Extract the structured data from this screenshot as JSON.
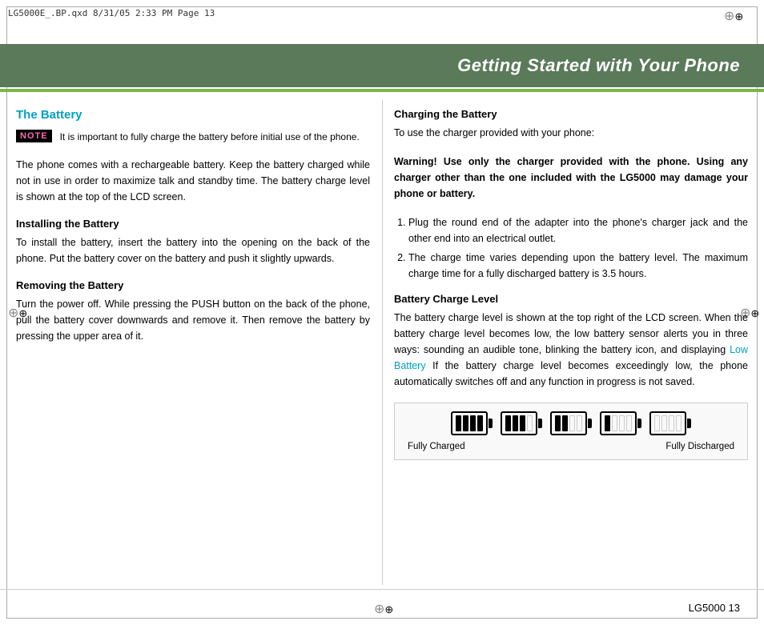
{
  "printer_header": "LG5000E_.BP.qxd   8/31/05   2:33 PM   Page 13",
  "title": "Getting Started with Your Phone",
  "left_column": {
    "section_title": "The Battery",
    "note_label": "NOTE",
    "note_text": "It is important to fully charge the battery before initial use of the phone.",
    "body_text": "The phone comes with a rechargeable battery. Keep the battery charged while not in use in order to maximize talk and standby time. The battery charge level is shown at the top of the LCD screen.",
    "installing_title": "Installing the Battery",
    "installing_text": "To install the battery, insert the battery into the opening on the back of the phone. Put the battery cover on the battery and push it slightly upwards.",
    "removing_title": "Removing the Battery",
    "removing_text": "Turn the power off. While pressing the PUSH button on the back of the phone, pull the battery cover downwards and remove it. Then remove the battery by pressing the upper area of it."
  },
  "right_column": {
    "charging_title": "Charging the Battery",
    "charging_intro": "To use the charger provided with your phone:",
    "charging_warning": "Warning! Use only the charger provided with the phone. Using any charger other than the one included with the LG5000 may damage your phone or battery.",
    "step1": "Plug the round end of the adapter into the phone's charger jack and the other end into an electrical outlet.",
    "step2": "The charge time varies depending upon the battery level. The maximum charge time for a fully discharged battery is 3.5 hours.",
    "battery_level_title": "Battery Charge Level",
    "battery_level_text1": "The battery charge level is shown at the top right of the LCD screen. When the battery charge level becomes low, the low battery sensor alerts you in three ways: sounding an audible tone, blinking the battery icon, and displaying",
    "low_battery_link": "Low  Battery",
    "battery_level_text2": "If the battery charge level becomes exceedingly low, the phone automatically switches off and any function in progress is not saved.",
    "fully_charged": "Fully Charged",
    "fully_discharged": "Fully Discharged"
  },
  "page_number": "LG5000  13"
}
